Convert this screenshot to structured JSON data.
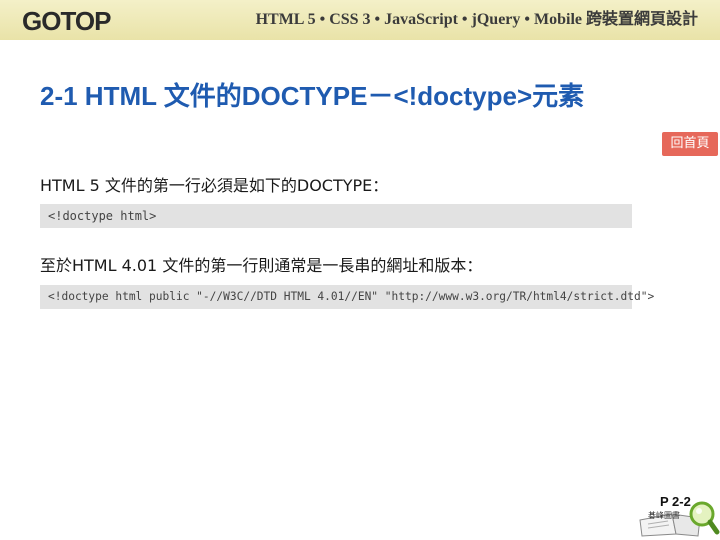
{
  "header": {
    "logo_text": "GOTOP",
    "series_title": "HTML 5 • CSS 3 • JavaScript • jQuery • Mobile 跨裝置網頁設計"
  },
  "slide": {
    "title": "2-1 HTML 文件的DOCTYPE－<!doctype>元素",
    "home_label": "回首頁",
    "paragraph_1": "HTML 5 文件的第一行必須是如下的DOCTYPE：",
    "code_1": "<!doctype html>",
    "paragraph_2": "至於HTML 4.01 文件的第一行則通常是一長串的網址和版本：",
    "code_2": "<!doctype html public \"-//W3C//DTD HTML 4.01//EN\" \"http://www.w3.org/TR/html4/strict.dtd\">"
  },
  "footer": {
    "page_number": "P 2-2",
    "book_label": "碁峰圖書"
  },
  "colors": {
    "title": "#1f5bb0",
    "home_button": "#e6685a",
    "header_bar": "#f0ebbd",
    "code_background": "#e2e2e2"
  }
}
